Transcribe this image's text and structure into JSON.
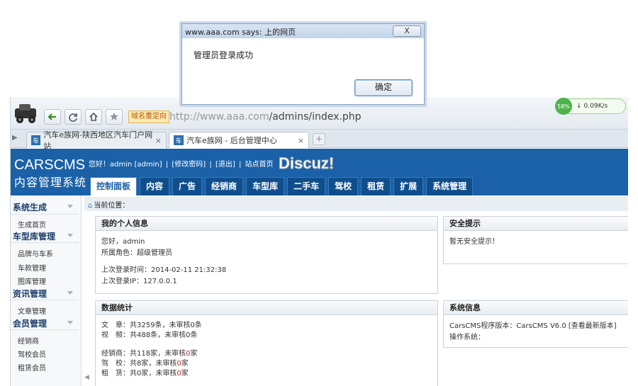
{
  "dialog": {
    "title": "www.aaa.com says: 上的网页",
    "close_label": "X",
    "message": "管理员登录成功",
    "ok_label": "确定"
  },
  "browser": {
    "redirect_tag": "域名重定向",
    "address_domain": "http://www.aaa.com",
    "address_path": "/admins/index.php",
    "speed_percent": "58%",
    "speed_rate": "0.09K/s",
    "tabs": [
      {
        "label": "汽车e族网-陕西地区汽车门户网站",
        "close": "×",
        "active": false
      },
      {
        "label": "汽车e族网 - 后台管理中心",
        "close": "×",
        "active": true
      }
    ],
    "new_tab": "+"
  },
  "header": {
    "brand_en": "CARSCMS",
    "brand_cn": "内容管理系统",
    "greeting": "您好！admin [admin]",
    "links": [
      "[修改密码]",
      "[退出]",
      "站点首页"
    ],
    "menu": [
      "控制面板",
      "内容",
      "广告",
      "经销商",
      "车型库",
      "二手车",
      "驾校",
      "租赁",
      "扩展",
      "系统管理"
    ],
    "active_menu": "控制面板"
  },
  "sidebar": {
    "groups": [
      {
        "title": "系统生成",
        "items": [
          "生成首页"
        ]
      },
      {
        "title": "车型库管理",
        "items": [
          "品牌与车系",
          "车款管理",
          "图库管理"
        ]
      },
      {
        "title": "资讯管理",
        "items": [
          "文章管理"
        ]
      },
      {
        "title": "会员管理",
        "items": [
          "经销商",
          "驾校会员",
          "租赁会员"
        ]
      }
    ]
  },
  "breadcrumb": "当前位置：",
  "panels": {
    "profile": {
      "title": "我的个人信息",
      "hello": "您好，admin",
      "role": "所属角色：超级管理员",
      "last_login_time": "上次登录时间：2014-02-11 21:32:38",
      "last_login_ip": "上次登录IP：127.0.0.1"
    },
    "security": {
      "title": "安全提示",
      "text": "暂无安全提示！"
    },
    "stats": {
      "title": "数据统计",
      "article": "文　章：共3259条，未审核0条",
      "video": "视　频：共488条，未审核0条",
      "dealer_prefix": "经销商：共118家，未审核",
      "dealer_num": "0",
      "dealer_suffix": "家",
      "school_prefix": "驾　校：共8家，未审核",
      "school_num": "0",
      "school_suffix": "家",
      "rental_prefix": "租　赁：共0家，未审核",
      "rental_num": "0",
      "rental_suffix": "家"
    },
    "sysinfo": {
      "title": "系统信息",
      "version": "CarsCMS程序版本：CarsCMS V6.0 [查看最新版本]",
      "os": "操作系统："
    }
  },
  "watermark": "Discuz!",
  "colors": {
    "header_blue": "#1a61a8",
    "menu_dark": "#0f4e8c",
    "alert_red": "#d02020"
  }
}
